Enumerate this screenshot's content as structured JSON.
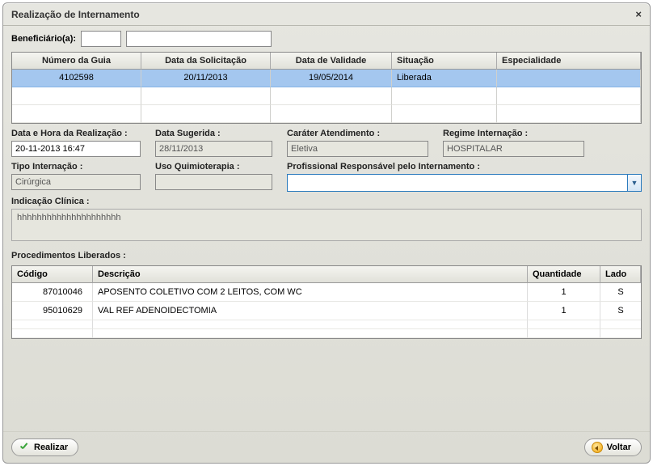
{
  "title": "Realização de Internamento",
  "beneficiario_label": "Beneficiário(a):",
  "beneficiario_code": "",
  "beneficiario_name": "",
  "guide_table": {
    "headers": {
      "num": "Número da Guia",
      "sol": "Data da Solicitação",
      "val": "Data de Validade",
      "sit": "Situação",
      "esp": "Especialidade"
    },
    "row1": {
      "num": "4102598",
      "sol": "20/11/2013",
      "val": "19/05/2014",
      "sit": "Liberada",
      "esp": ""
    }
  },
  "fields": {
    "datahora_label": "Data e Hora da Realização :",
    "datahora_value": "20-11-2013 16:47",
    "datasug_label": "Data Sugerida :",
    "datasug_value": "28/11/2013",
    "carater_label": "Caráter Atendimento :",
    "carater_value": "Eletiva",
    "regime_label": "Regime Internação :",
    "regime_value": "HOSPITALAR",
    "tipo_label": "Tipo Internação :",
    "tipo_value": "Cirúrgica",
    "quimio_label": "Uso Quimioterapia :",
    "quimio_value": "",
    "prof_label": "Profissional Responsável pelo Internamento :",
    "prof_value": "",
    "indic_label": "Indicação Clínica :",
    "indic_value": "hhhhhhhhhhhhhhhhhhhhh"
  },
  "proc": {
    "title": "Procedimentos Liberados :",
    "headers": {
      "cod": "Código",
      "desc": "Descrição",
      "qtd": "Quantidade",
      "lado": "Lado"
    },
    "rows": [
      {
        "cod": "87010046",
        "desc": "APOSENTO COLETIVO COM 2 LEITOS, COM WC",
        "qtd": "1",
        "lado": "S"
      },
      {
        "cod": "95010629",
        "desc": "VAL REF ADENOIDECTOMIA",
        "qtd": "1",
        "lado": "S"
      }
    ]
  },
  "buttons": {
    "realizar": "Realizar",
    "voltar": "Voltar"
  }
}
